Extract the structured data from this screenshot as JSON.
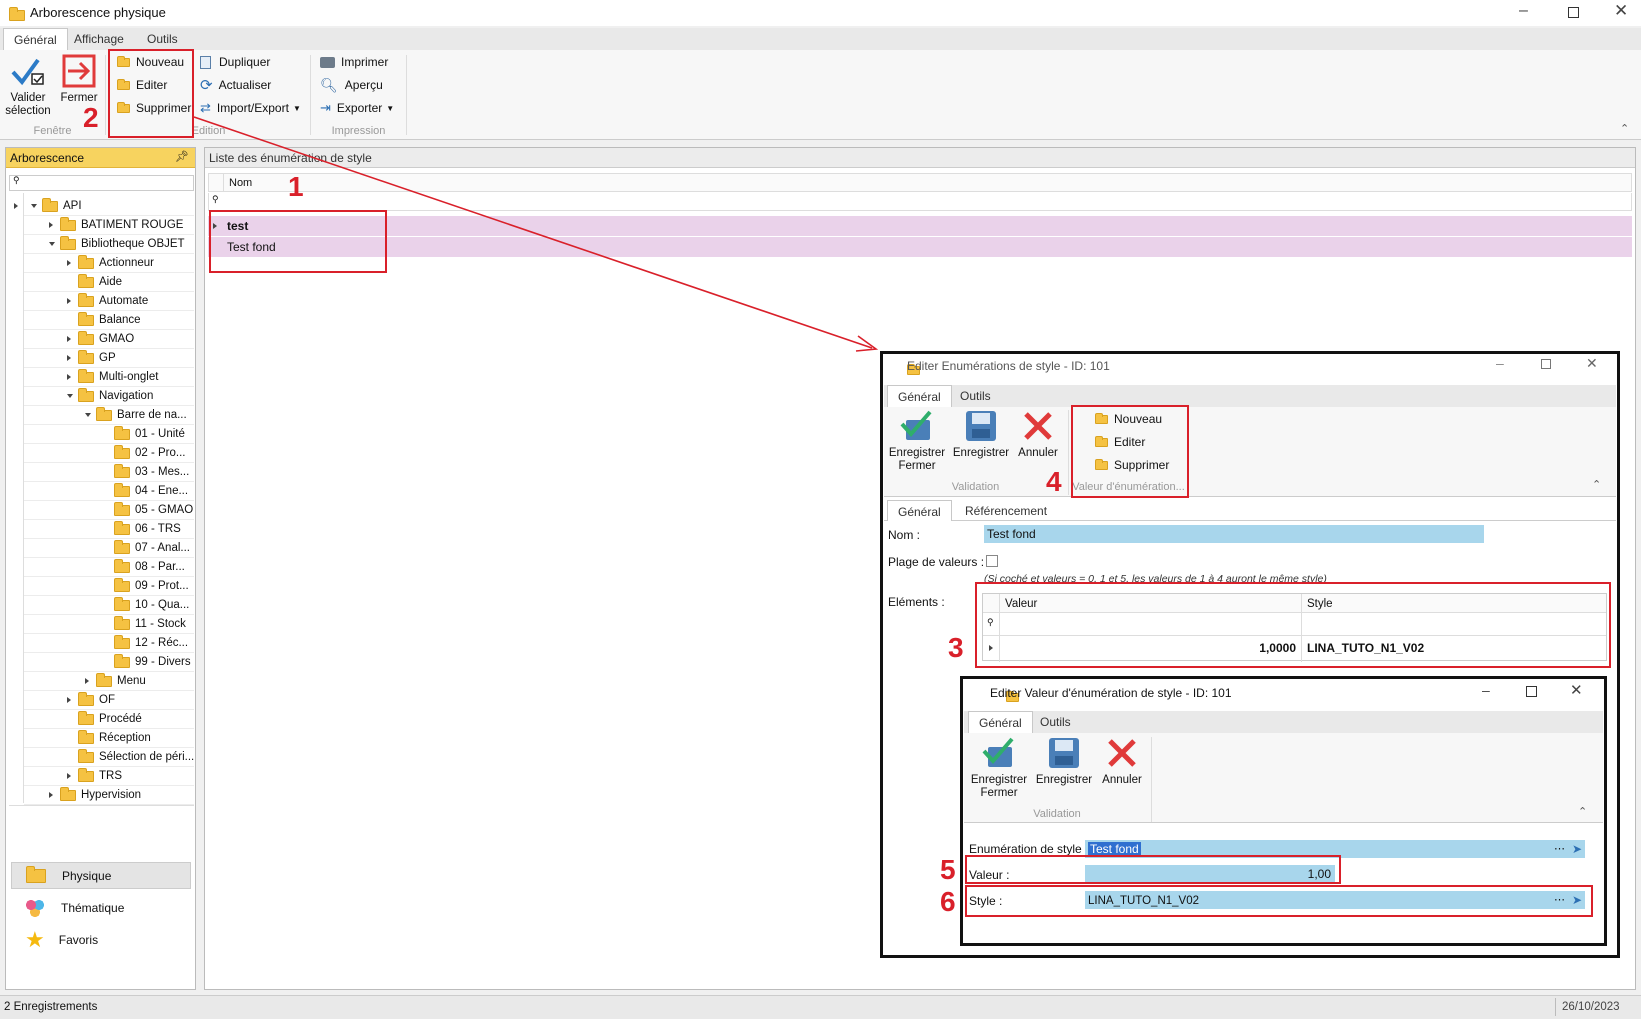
{
  "app": {
    "title": "Arborescence physique"
  },
  "ribbon": {
    "tabs": [
      "Général",
      "Affichage",
      "Outils"
    ],
    "fenetre": {
      "valider": [
        "Valider",
        "sélection"
      ],
      "fermer": "Fermer",
      "group": "Fenêtre"
    },
    "edition": {
      "nouveau": "Nouveau",
      "editer": "Editer",
      "supprimer": "Supprimer",
      "dupliquer": "Dupliquer",
      "actualiser": "Actualiser",
      "import_export": "Import/Export",
      "group": "Edition"
    },
    "impression": {
      "imprimer": "Imprimer",
      "apercu": "Aperçu",
      "exporter": "Exporter",
      "group": "Impression"
    }
  },
  "sidebar": {
    "header": "Arborescence",
    "tree": [
      {
        "label": "API",
        "depth": 0
      },
      {
        "label": "BATIMENT ROUGE",
        "depth": 1
      },
      {
        "label": "Bibliotheque OBJET",
        "depth": 1
      },
      {
        "label": "Actionneur",
        "depth": 2
      },
      {
        "label": "Aide",
        "depth": 2
      },
      {
        "label": "Automate",
        "depth": 2
      },
      {
        "label": "Balance",
        "depth": 2
      },
      {
        "label": "GMAO",
        "depth": 2
      },
      {
        "label": "GP",
        "depth": 2
      },
      {
        "label": "Multi-onglet",
        "depth": 2
      },
      {
        "label": "Navigation",
        "depth": 2
      },
      {
        "label": "Barre de na...",
        "depth": 3
      },
      {
        "label": "01 - Unité",
        "depth": 4
      },
      {
        "label": "02 - Pro...",
        "depth": 4
      },
      {
        "label": "03 - Mes...",
        "depth": 4
      },
      {
        "label": "04 - Ene...",
        "depth": 4
      },
      {
        "label": "05 - GMAO",
        "depth": 4
      },
      {
        "label": "06 - TRS",
        "depth": 4
      },
      {
        "label": "07 - Anal...",
        "depth": 4
      },
      {
        "label": "08 - Par...",
        "depth": 4
      },
      {
        "label": "09 - Prot...",
        "depth": 4
      },
      {
        "label": "10 - Qua...",
        "depth": 4
      },
      {
        "label": "11 - Stock",
        "depth": 4
      },
      {
        "label": "12 - Réc...",
        "depth": 4
      },
      {
        "label": "99 - Divers",
        "depth": 4
      },
      {
        "label": "Menu",
        "depth": 3
      },
      {
        "label": "OF",
        "depth": 2
      },
      {
        "label": "Procédé",
        "depth": 2
      },
      {
        "label": "Réception",
        "depth": 2
      },
      {
        "label": "Sélection de péri...",
        "depth": 2
      },
      {
        "label": "TRS",
        "depth": 2
      },
      {
        "label": "Hypervision",
        "depth": 1
      }
    ],
    "nav": [
      "Physique",
      "Thématique",
      "Favoris"
    ]
  },
  "main": {
    "title": "Liste des énumération de style",
    "column": "Nom",
    "rows": [
      "test",
      "Test fond"
    ]
  },
  "status": {
    "left": "2 Enregistrements",
    "right": "26/10/2023"
  },
  "annotations": [
    "1",
    "2",
    "3",
    "4",
    "5",
    "6"
  ],
  "dialog1": {
    "title": "Editer Enumérations de style - ID: 101",
    "tabs": [
      "Général",
      "Outils"
    ],
    "validation": {
      "enregistrer_fermer": [
        "Enregistrer",
        "Fermer"
      ],
      "enregistrer": "Enregistrer",
      "annuler": "Annuler",
      "group": "Validation"
    },
    "valeur": {
      "nouveau": "Nouveau",
      "editer": "Editer",
      "supprimer": "Supprimer",
      "group": "Valeur d'énumération..."
    },
    "subtabs": [
      "Général",
      "Référencement"
    ],
    "nom_label": "Nom :",
    "nom_value": "Test fond",
    "plage_label": "Plage de valeurs :",
    "hint": "(Si coché et valeurs = 0, 1 et 5, les valeurs de 1 à 4 auront le même style)",
    "elements_label": "Eléments :",
    "grid": {
      "columns": [
        "Valeur",
        "Style"
      ],
      "row": [
        "1,0000",
        "LINA_TUTO_N1_V02"
      ]
    }
  },
  "dialog2": {
    "title": "Editer Valeur d'énumération de style - ID: 101",
    "tabs": [
      "Général",
      "Outils"
    ],
    "validation": {
      "enregistrer_fermer": [
        "Enregistrer",
        "Fermer"
      ],
      "enregistrer": "Enregistrer",
      "annuler": "Annuler",
      "group": "Validation"
    },
    "enum_label": "Enumération de style :",
    "enum_value": "Test fond",
    "valeur_label": "Valeur :",
    "valeur_value": "1,00",
    "style_label": "Style :",
    "style_value": "LINA_TUTO_N1_V02"
  }
}
